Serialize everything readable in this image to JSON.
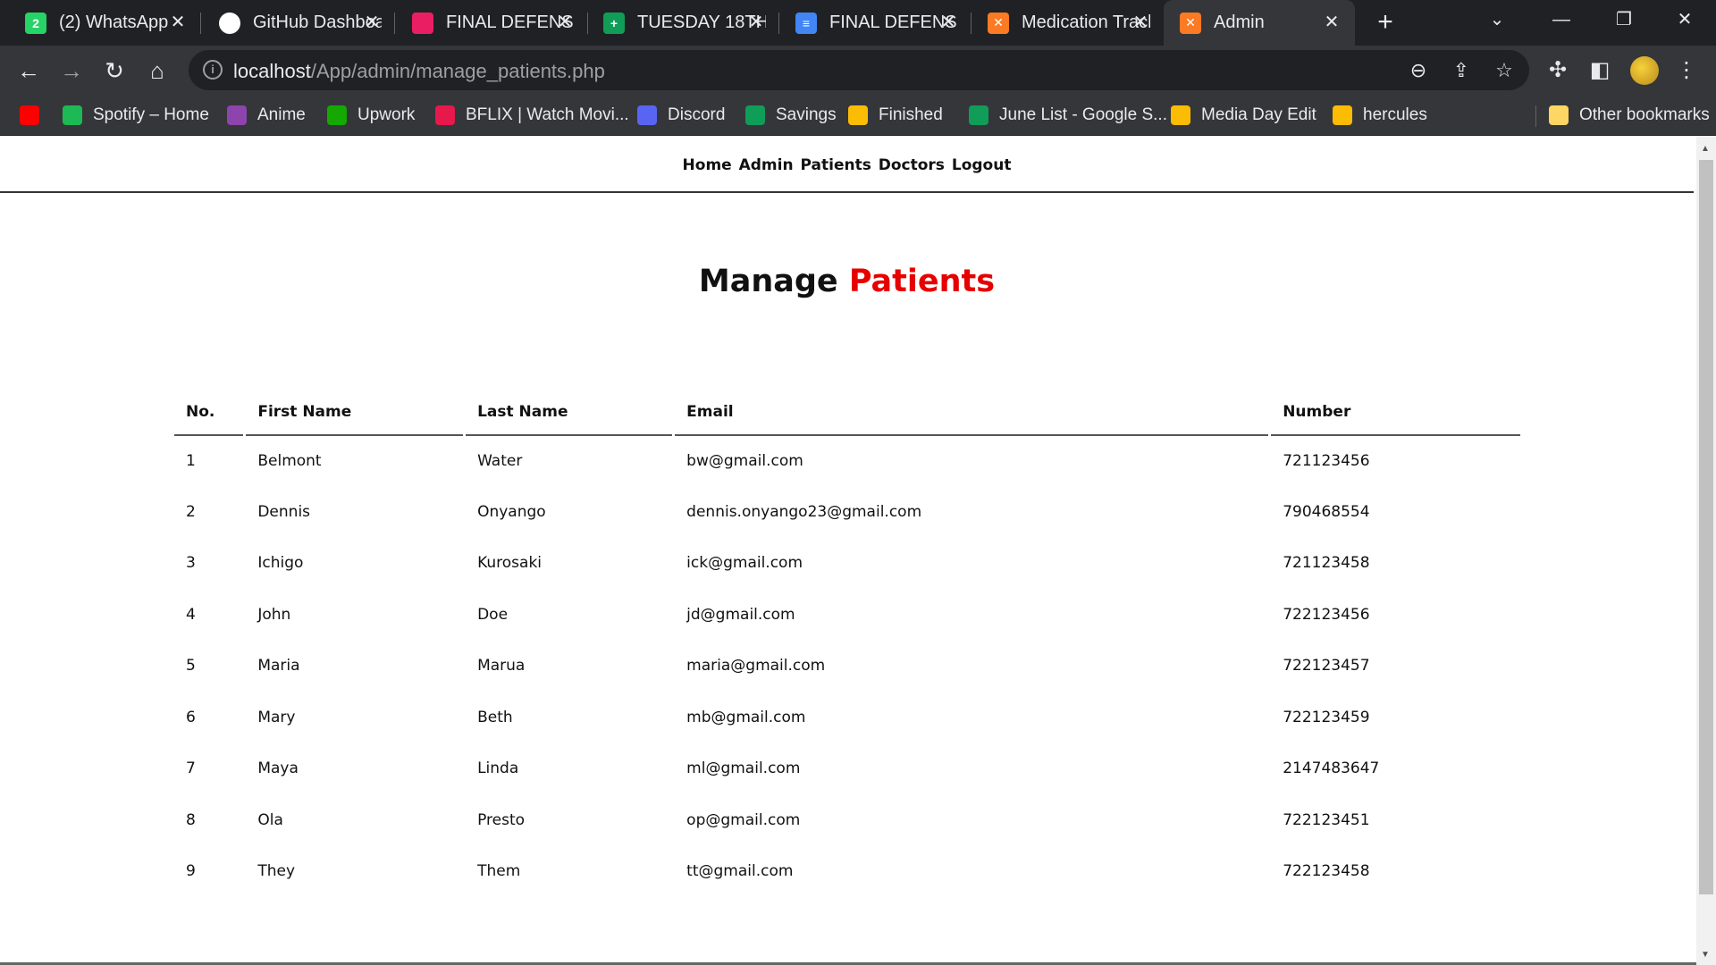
{
  "browser": {
    "tabs": [
      {
        "title": "(2) WhatsApp",
        "icon": "whatsapp-icon",
        "color": "#25d366",
        "glyph": "2"
      },
      {
        "title": "GitHub Dashboard",
        "icon": "github-icon",
        "color": "#ffffff",
        "glyph": ""
      },
      {
        "title": "FINAL DEFENSE",
        "icon": "google-classroom-icon",
        "color": "#e91e63",
        "glyph": ""
      },
      {
        "title": "TUESDAY 18TH",
        "icon": "google-sheets-icon",
        "color": "#0f9d58",
        "glyph": "+"
      },
      {
        "title": "FINAL DEFENSE",
        "icon": "google-docs-icon",
        "color": "#4285f4",
        "glyph": "≡"
      },
      {
        "title": "Medication Tracker",
        "icon": "xampp-icon",
        "color": "#fb7a24",
        "glyph": "✕"
      },
      {
        "title": "Admin",
        "icon": "xampp-icon",
        "color": "#fb7a24",
        "glyph": "✕"
      }
    ],
    "active_tab": 6,
    "url_host": "localhost",
    "url_path": "/App/admin/manage_patients.php",
    "bookmarks": [
      {
        "label": "",
        "icon": "youtube-icon",
        "color": "#ff0000"
      },
      {
        "label": "Spotify – Home",
        "icon": "spotify-icon",
        "color": "#1db954"
      },
      {
        "label": "Anime",
        "icon": "play-icon",
        "color": "#8e44ad"
      },
      {
        "label": "Upwork",
        "icon": "upwork-icon",
        "color": "#14a800"
      },
      {
        "label": "BFLIX | Watch Movi...",
        "icon": "bflix-icon",
        "color": "#e6184c"
      },
      {
        "label": "Discord",
        "icon": "discord-icon",
        "color": "#5865f2"
      },
      {
        "label": "Savings",
        "icon": "google-sheets-icon",
        "color": "#0f9d58"
      },
      {
        "label": "Finished",
        "icon": "google-drive-icon",
        "color": "#fbbc04"
      },
      {
        "label": "June List - Google S...",
        "icon": "google-sheets-icon",
        "color": "#0f9d58"
      },
      {
        "label": "Media Day Edit",
        "icon": "google-drive-icon",
        "color": "#fbbc04"
      },
      {
        "label": "hercules",
        "icon": "google-drive-icon",
        "color": "#fbbc04"
      }
    ],
    "other_bookmarks": "Other bookmarks"
  },
  "nav": {
    "links": [
      "Home",
      "Admin",
      "Patients",
      "Doctors",
      "Logout"
    ]
  },
  "heading": {
    "word1": "Manage",
    "word2": "Patients",
    "accent_color": "#e60000"
  },
  "table": {
    "columns": [
      "No.",
      "First Name",
      "Last Name",
      "Email",
      "Number"
    ],
    "rows": [
      [
        "1",
        "Belmont",
        "Water",
        "bw@gmail.com",
        "721123456"
      ],
      [
        "2",
        "Dennis",
        "Onyango",
        "dennis.onyango23@gmail.com",
        "790468554"
      ],
      [
        "3",
        "Ichigo",
        "Kurosaki",
        "ick@gmail.com",
        "721123458"
      ],
      [
        "4",
        "John",
        "Doe",
        "jd@gmail.com",
        "722123456"
      ],
      [
        "5",
        "Maria",
        "Marua",
        "maria@gmail.com",
        "722123457"
      ],
      [
        "6",
        "Mary",
        "Beth",
        "mb@gmail.com",
        "722123459"
      ],
      [
        "7",
        "Maya",
        "Linda",
        "ml@gmail.com",
        "2147483647"
      ],
      [
        "8",
        "Ola",
        "Presto",
        "op@gmail.com",
        "722123451"
      ],
      [
        "9",
        "They",
        "Them",
        "tt@gmail.com",
        "722123458"
      ]
    ]
  }
}
